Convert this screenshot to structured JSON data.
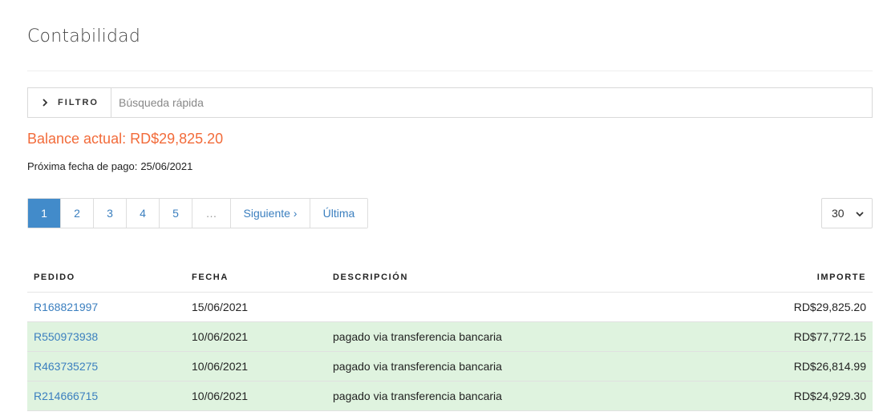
{
  "page": {
    "title": "Contabilidad"
  },
  "filter": {
    "label": "FILTRO",
    "search_placeholder": "Búsqueda rápida"
  },
  "balance": {
    "label": "Balance actual:",
    "value": "RD$29,825.20"
  },
  "next_payment": {
    "label": "Próxima fecha de pago:",
    "value": "25/06/2021"
  },
  "pagination": {
    "pages": [
      "1",
      "2",
      "3",
      "4",
      "5"
    ],
    "ellipsis": "…",
    "next": "Siguiente ›",
    "last": "Última",
    "current": "1"
  },
  "per_page": {
    "value": "30"
  },
  "table": {
    "headers": [
      "PEDIDO",
      "FECHA",
      "DESCRIPCIÓN",
      "IMPORTE"
    ],
    "rows": [
      {
        "order": "R168821997",
        "date": "15/06/2021",
        "description": "",
        "amount": "RD$29,825.20",
        "status": "pending"
      },
      {
        "order": "R550973938",
        "date": "10/06/2021",
        "description": "pagado via transferencia bancaria",
        "amount": "RD$77,772.15",
        "status": "paid"
      },
      {
        "order": "R463735275",
        "date": "10/06/2021",
        "description": "pagado via transferencia bancaria",
        "amount": "RD$26,814.99",
        "status": "paid"
      },
      {
        "order": "R214666715",
        "date": "10/06/2021",
        "description": "pagado via transferencia bancaria",
        "amount": "RD$24,929.30",
        "status": "paid"
      }
    ]
  },
  "colors": {
    "accent": "#428bca",
    "link": "#3b7fbf",
    "balance": "#f26b3a",
    "paid_row": "#dff3df"
  },
  "icons": {
    "filter": "chevron-right-icon",
    "select": "chevron-down-icon"
  }
}
